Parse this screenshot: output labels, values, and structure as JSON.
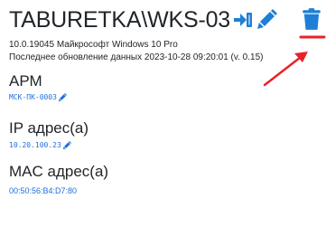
{
  "device": {
    "title": "TABURETKA\\WKS-03",
    "os": "10.0.19045 Майкрософт Windows 10 Pro",
    "last_update": "Последнее обновление данных 2023-10-28 09:20:01 (v. 0.15)"
  },
  "fields": [
    {
      "label": "АРМ",
      "value": "МСК-ПК-0003"
    },
    {
      "label": "IP адрес(а)",
      "value": "10.20.100.23"
    },
    {
      "label": "MAC адрес(а)",
      "value": "00:50:56:B4:D7:80"
    }
  ],
  "icons": {
    "login": "sign-in-icon",
    "edit": "pencil-icon",
    "delete": "trash-icon"
  },
  "colors": {
    "accent": "#1e7fd6",
    "link": "#1e6fe0",
    "annotation": "#e8222a"
  }
}
